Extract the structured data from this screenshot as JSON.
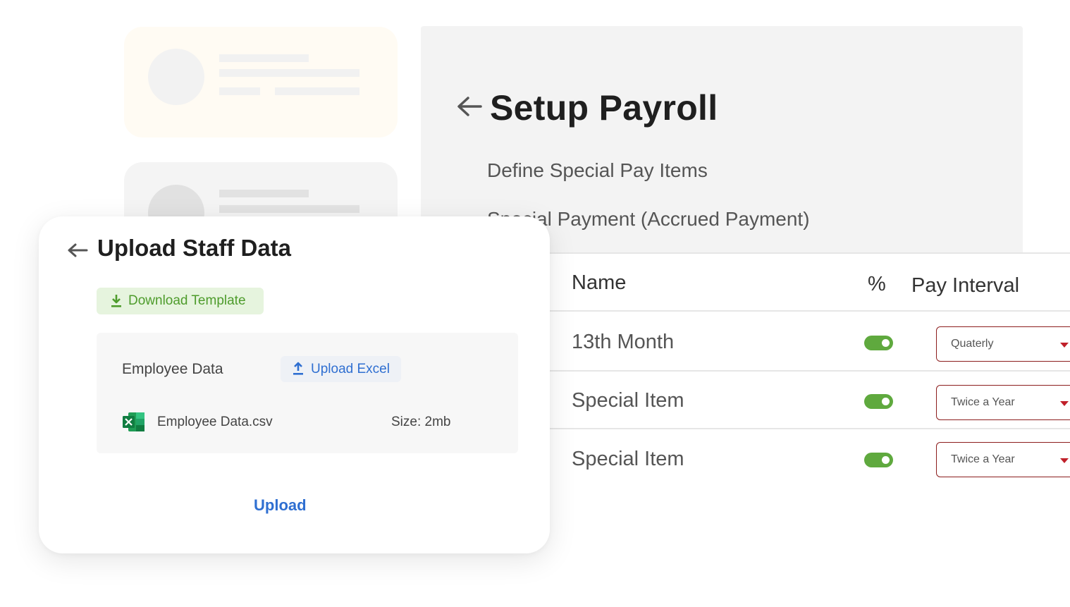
{
  "payroll": {
    "title": "Setup Payroll",
    "subtitle_1": "Define Special Pay Items",
    "subtitle_2": "Special Payment (Accrued Payment)",
    "table": {
      "headers": [
        "Name",
        "%",
        "Pay Interval"
      ],
      "rows": [
        {
          "name": "13th Month",
          "enabled": true,
          "interval": "Quaterly"
        },
        {
          "name": "Special Item",
          "enabled": true,
          "interval": "Twice a Year"
        },
        {
          "name": "Special Item",
          "enabled": true,
          "interval": "Twice a Year"
        }
      ]
    }
  },
  "upload": {
    "title": "Upload Staff Data",
    "download_template_label": "Download Template",
    "employee_data_label": "Employee Data",
    "upload_excel_label": "Upload Excel",
    "file": {
      "name": "Employee Data.csv",
      "size": "Size: 2mb"
    },
    "upload_label": "Upload"
  },
  "colors": {
    "toggle_on": "#5fa93e",
    "select_border": "#8c1d1d",
    "select_caret": "#c0202a",
    "accent_blue": "#2f6fd1",
    "accent_green": "#4e9c2c"
  },
  "icons": [
    "back-arrow-icon",
    "download-icon",
    "upload-icon",
    "excel-icon",
    "caret-down-icon"
  ]
}
